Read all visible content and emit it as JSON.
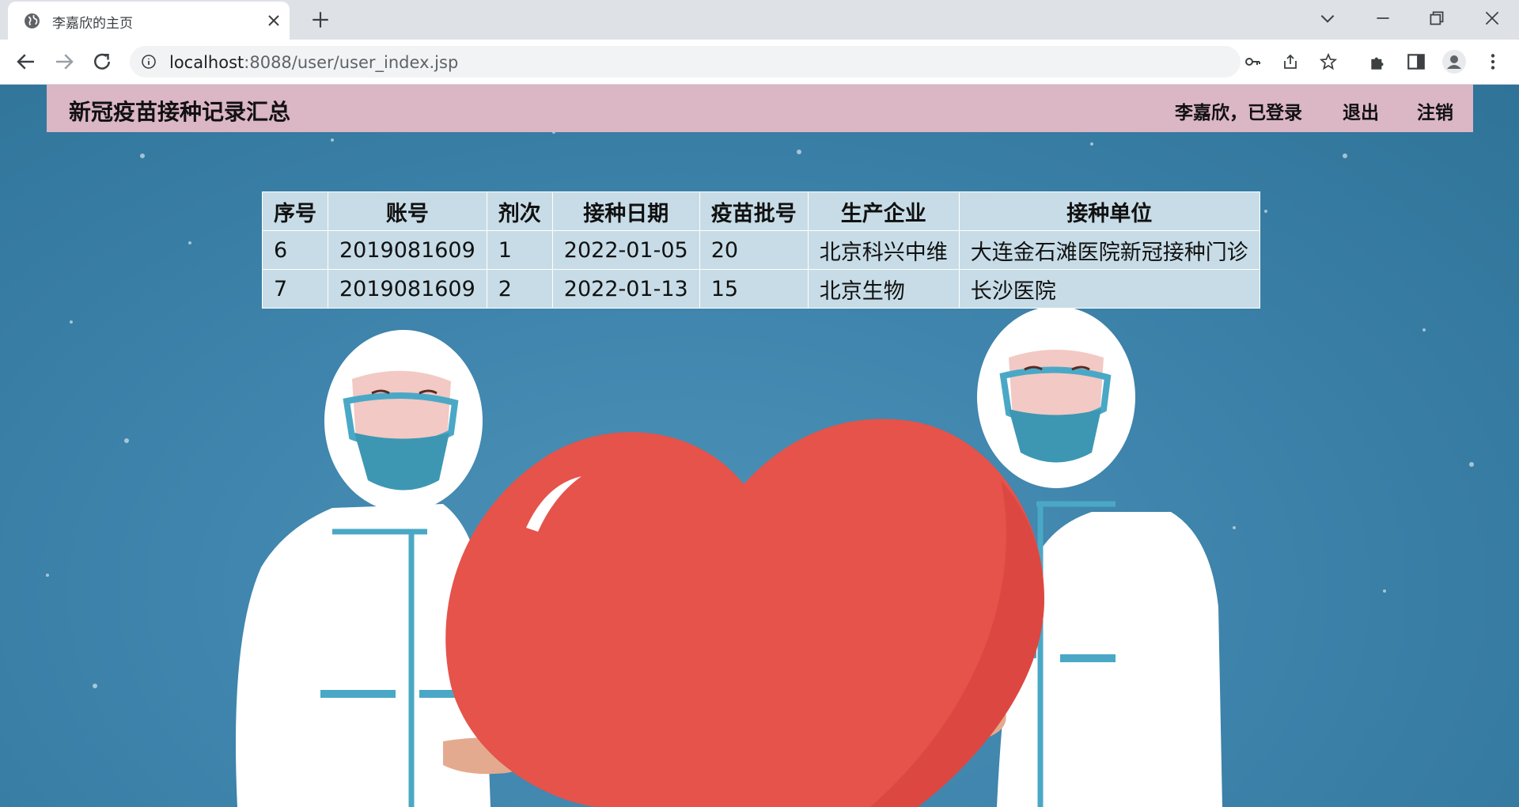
{
  "browser": {
    "tab_title": "李嘉欣的主页",
    "url_host": "localhost",
    "url_rest": ":8088/user/user_index.jsp"
  },
  "page": {
    "title": "新冠疫苗接种记录汇总",
    "user_status": "李嘉欣，已登录",
    "logout": "退出",
    "cancel_account": "注销"
  },
  "table": {
    "headers": [
      "序号",
      "账号",
      "剂次",
      "接种日期",
      "疫苗批号",
      "生产企业",
      "接种单位"
    ],
    "rows": [
      [
        "6",
        "2019081609",
        "1",
        "2022-01-05",
        "20",
        "北京科兴中维",
        "大连金石滩医院新冠接种门诊"
      ],
      [
        "7",
        "2019081609",
        "2",
        "2022-01-13",
        "15",
        "北京生物",
        "长沙医院"
      ]
    ]
  },
  "colors": {
    "header_bar": "#dbb6c5",
    "table_bg": "#c7dce6",
    "page_bg": "#3c7fa3",
    "heart": "#e5534b"
  }
}
